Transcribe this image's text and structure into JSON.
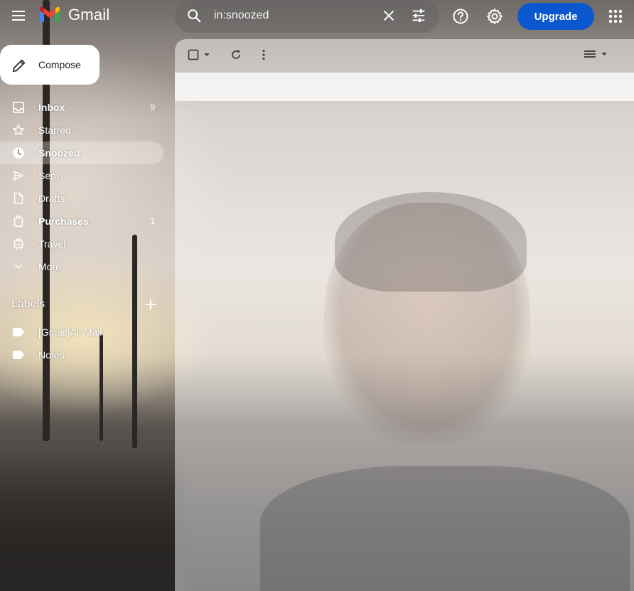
{
  "app": {
    "name": "Gmail"
  },
  "search": {
    "query": "in:snoozed"
  },
  "header": {
    "upgrade_label": "Upgrade"
  },
  "compose": {
    "label": "Compose"
  },
  "nav": {
    "items": [
      {
        "label": "Inbox",
        "count": "9",
        "icon": "inbox-icon",
        "bold": true,
        "active": false
      },
      {
        "label": "Starred",
        "count": "",
        "icon": "star-icon",
        "bold": false,
        "active": false
      },
      {
        "label": "Snoozed",
        "count": "",
        "icon": "clock-icon",
        "bold": true,
        "active": true
      },
      {
        "label": "Sent",
        "count": "",
        "icon": "send-icon",
        "bold": false,
        "active": false
      },
      {
        "label": "Drafts",
        "count": "",
        "icon": "draft-icon",
        "bold": false,
        "active": false
      },
      {
        "label": "Purchases",
        "count": "1",
        "icon": "purchases-icon",
        "bold": true,
        "active": false
      },
      {
        "label": "Travel",
        "count": "",
        "icon": "luggage-icon",
        "bold": false,
        "active": false
      },
      {
        "label": "More",
        "count": "",
        "icon": "chevron-down-icon",
        "bold": false,
        "active": false
      }
    ]
  },
  "labels": {
    "title": "Labels",
    "items": [
      {
        "label": "[Gmail]All Mail"
      },
      {
        "label": "Notes"
      }
    ]
  },
  "colors": {
    "accent": "#0b57d0",
    "gmail_red": "#ea4335",
    "gmail_blue": "#4285f4",
    "gmail_yellow": "#fbbc04",
    "gmail_green": "#34a853"
  }
}
